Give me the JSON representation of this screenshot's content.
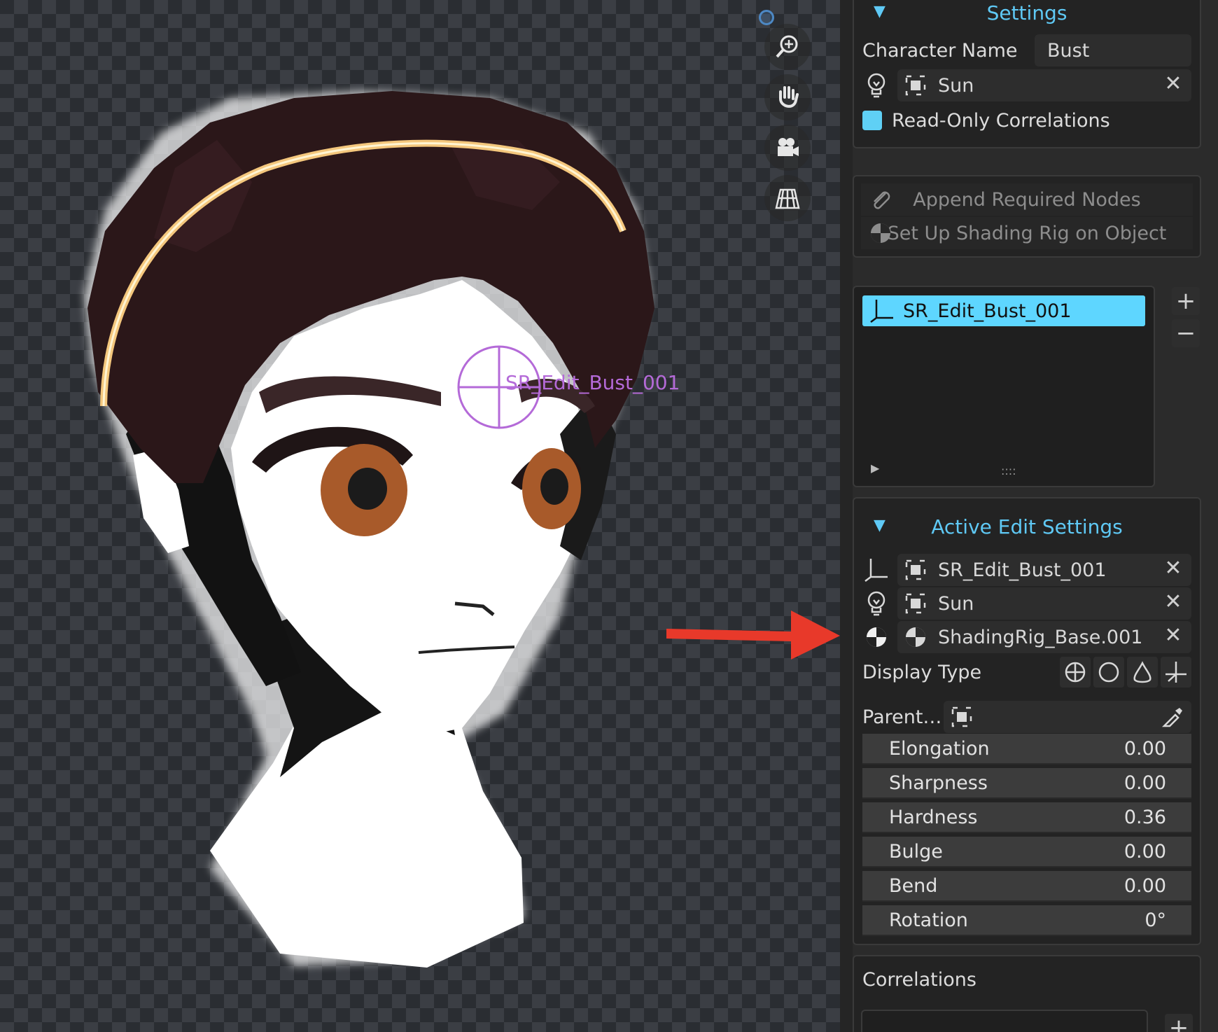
{
  "viewport": {
    "object_label": "SR_Edit_Bust_001",
    "nav_icons": [
      "zoom-icon",
      "hand-pan-icon",
      "camera-icon",
      "perspective-grid-icon"
    ]
  },
  "settings": {
    "title": "Settings",
    "character_name_label": "Character Name",
    "character_name_value": "Bust",
    "light_object": "Sun",
    "read_only_label": "Read-Only Correlations"
  },
  "actions": {
    "append_nodes": "Append Required Nodes",
    "setup_rig": "Set Up Shading Rig on Object"
  },
  "edit_list": {
    "items": [
      "SR_Edit_Bust_001"
    ],
    "grip": "::::",
    "add": "+",
    "remove": "−"
  },
  "active_edit": {
    "title": "Active Edit Settings",
    "empty_object": "SR_Edit_Bust_001",
    "light_object": "Sun",
    "rig_object": "ShadingRig_Base.001",
    "display_type_label": "Display Type",
    "parent_label": "Parent…",
    "sliders": [
      {
        "label": "Elongation",
        "value": "0.00"
      },
      {
        "label": "Sharpness",
        "value": "0.00"
      },
      {
        "label": "Hardness",
        "value": "0.36"
      },
      {
        "label": "Bulge",
        "value": "0.00"
      },
      {
        "label": "Bend",
        "value": "0.00"
      },
      {
        "label": "Rotation",
        "value": "0°"
      }
    ]
  },
  "correlations": {
    "title": "Correlations",
    "add": "+"
  },
  "colors": {
    "accent": "#5fc9f5",
    "selection": "#5ed6ff",
    "arrow": "#e8392a",
    "empty_label": "#b46ad8"
  }
}
